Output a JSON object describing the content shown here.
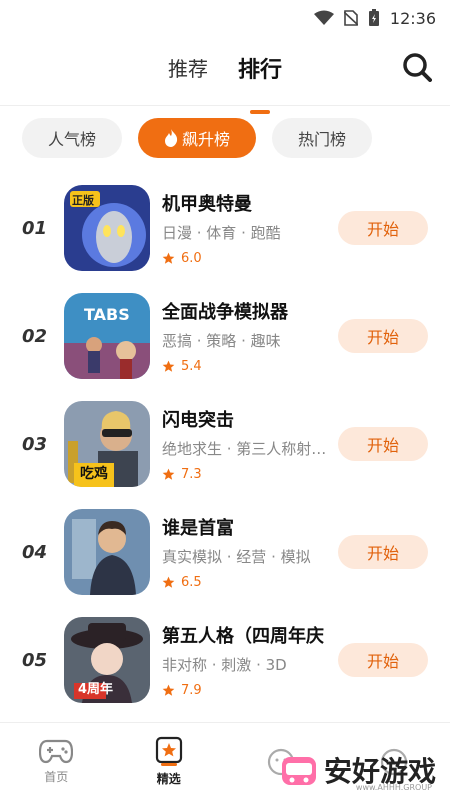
{
  "status": {
    "time": "12:36"
  },
  "header": {
    "tabs": [
      {
        "label": "推荐"
      },
      {
        "label": "排行"
      }
    ],
    "search_icon": "search-icon"
  },
  "filters": [
    {
      "label": "人气榜"
    },
    {
      "label": "飙升榜",
      "icon": "flame-icon"
    },
    {
      "label": "热门榜"
    }
  ],
  "games": [
    {
      "rank": "01",
      "name": "机甲奥特曼",
      "tags": "日漫 · 体育 · 跑酷",
      "rating": "6.0",
      "button": "开始",
      "badge": "正版"
    },
    {
      "rank": "02",
      "name": "全面战争模拟器",
      "tags": "恶搞 · 策略 · 趣味",
      "rating": "5.4",
      "button": "开始",
      "badge": "TABS"
    },
    {
      "rank": "03",
      "name": "闪电突击",
      "tags": "绝地求生 · 第三人称射…",
      "rating": "7.3",
      "button": "开始",
      "badge": "吃鸡"
    },
    {
      "rank": "04",
      "name": "谁是首富",
      "tags": "真实模拟 · 经营 · 模拟",
      "rating": "6.5",
      "button": "开始"
    },
    {
      "rank": "05",
      "name": "第五人格（四周年庆",
      "tags": "非对称 · 刺激 · 3D",
      "rating": "7.9",
      "button": "开始",
      "badge": "4周年"
    }
  ],
  "bottom_nav": [
    {
      "label": "首页",
      "icon": "gamepad-icon"
    },
    {
      "label": "精选",
      "icon": "star-bookmark-icon"
    },
    {
      "label": "",
      "icon": "face-icon"
    },
    {
      "label": "",
      "icon": "face-icon"
    }
  ],
  "watermark": {
    "text": "安好游戏",
    "sub": "www.AHHH.GROUP"
  },
  "colors": {
    "accent": "#f06e12",
    "button_bg": "#fde8da",
    "rank_highlight": "#f7c32e"
  }
}
